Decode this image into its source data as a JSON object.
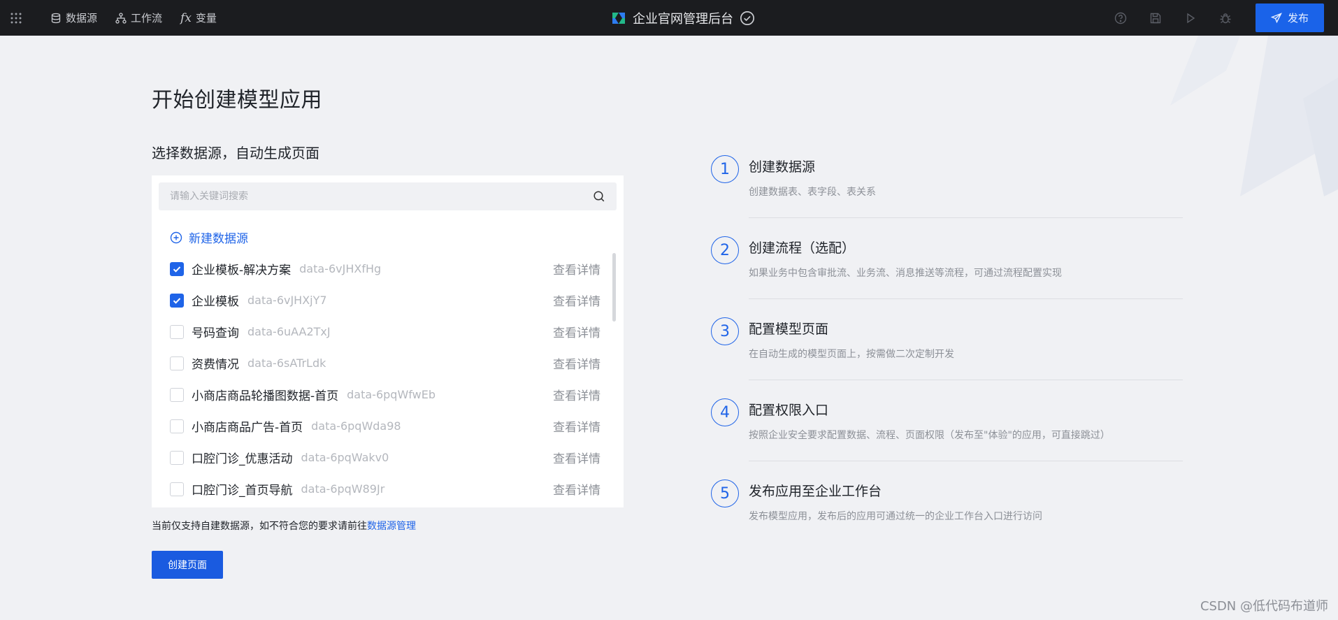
{
  "topbar": {
    "nav": [
      {
        "label": "数据源",
        "icon": "database-icon"
      },
      {
        "label": "工作流",
        "icon": "workflow-icon"
      },
      {
        "label": "变量",
        "icon": "fx-icon"
      }
    ],
    "app_title": "企业官网管理后台",
    "publish_label": "发布"
  },
  "main": {
    "title": "开始创建模型应用",
    "subtitle": "选择数据源，自动生成页面",
    "search_placeholder": "请输入关键词搜索",
    "new_datasource": "新建数据源",
    "detail_label": "查看详情",
    "datasources": [
      {
        "name": "企业模板-解决方案",
        "code": "data-6vJHXfHg",
        "checked": true
      },
      {
        "name": "企业模板",
        "code": "data-6vJHXjY7",
        "checked": true
      },
      {
        "name": "号码查询",
        "code": "data-6uAA2TxJ",
        "checked": false
      },
      {
        "name": "资费情况",
        "code": "data-6sATrLdk",
        "checked": false
      },
      {
        "name": "小商店商品轮播图数据-首页",
        "code": "data-6pqWfwEb",
        "checked": false
      },
      {
        "name": "小商店商品广告-首页",
        "code": "data-6pqWda98",
        "checked": false
      },
      {
        "name": "口腔门诊_优惠活动",
        "code": "data-6pqWakv0",
        "checked": false
      },
      {
        "name": "口腔门诊_首页导航",
        "code": "data-6pqW89Jr",
        "checked": false
      }
    ],
    "note_prefix": "当前仅支持自建数据源，如不符合您的要求请前往",
    "note_link": "数据源管理",
    "create_button": "创建页面"
  },
  "steps": [
    {
      "num": "1",
      "title": "创建数据源",
      "desc": "创建数据表、表字段、表关系"
    },
    {
      "num": "2",
      "title": "创建流程（选配）",
      "desc": "如果业务中包含审批流、业务流、消息推送等流程，可通过流程配置实现"
    },
    {
      "num": "3",
      "title": "配置模型页面",
      "desc": "在自动生成的模型页面上，按需做二次定制开发"
    },
    {
      "num": "4",
      "title": "配置权限入口",
      "desc": "按照企业安全要求配置数据、流程、页面权限（发布至\"体验\"的应用，可直接跳过）"
    },
    {
      "num": "5",
      "title": "发布应用至企业工作台",
      "desc": "发布模型应用，发布后的应用可通过统一的企业工作台入口进行访问"
    }
  ],
  "watermark": "CSDN @低代码布道师",
  "colors": {
    "accent": "#1f64e8",
    "topbar": "#1b1c1f",
    "background": "#f0f1f4"
  }
}
